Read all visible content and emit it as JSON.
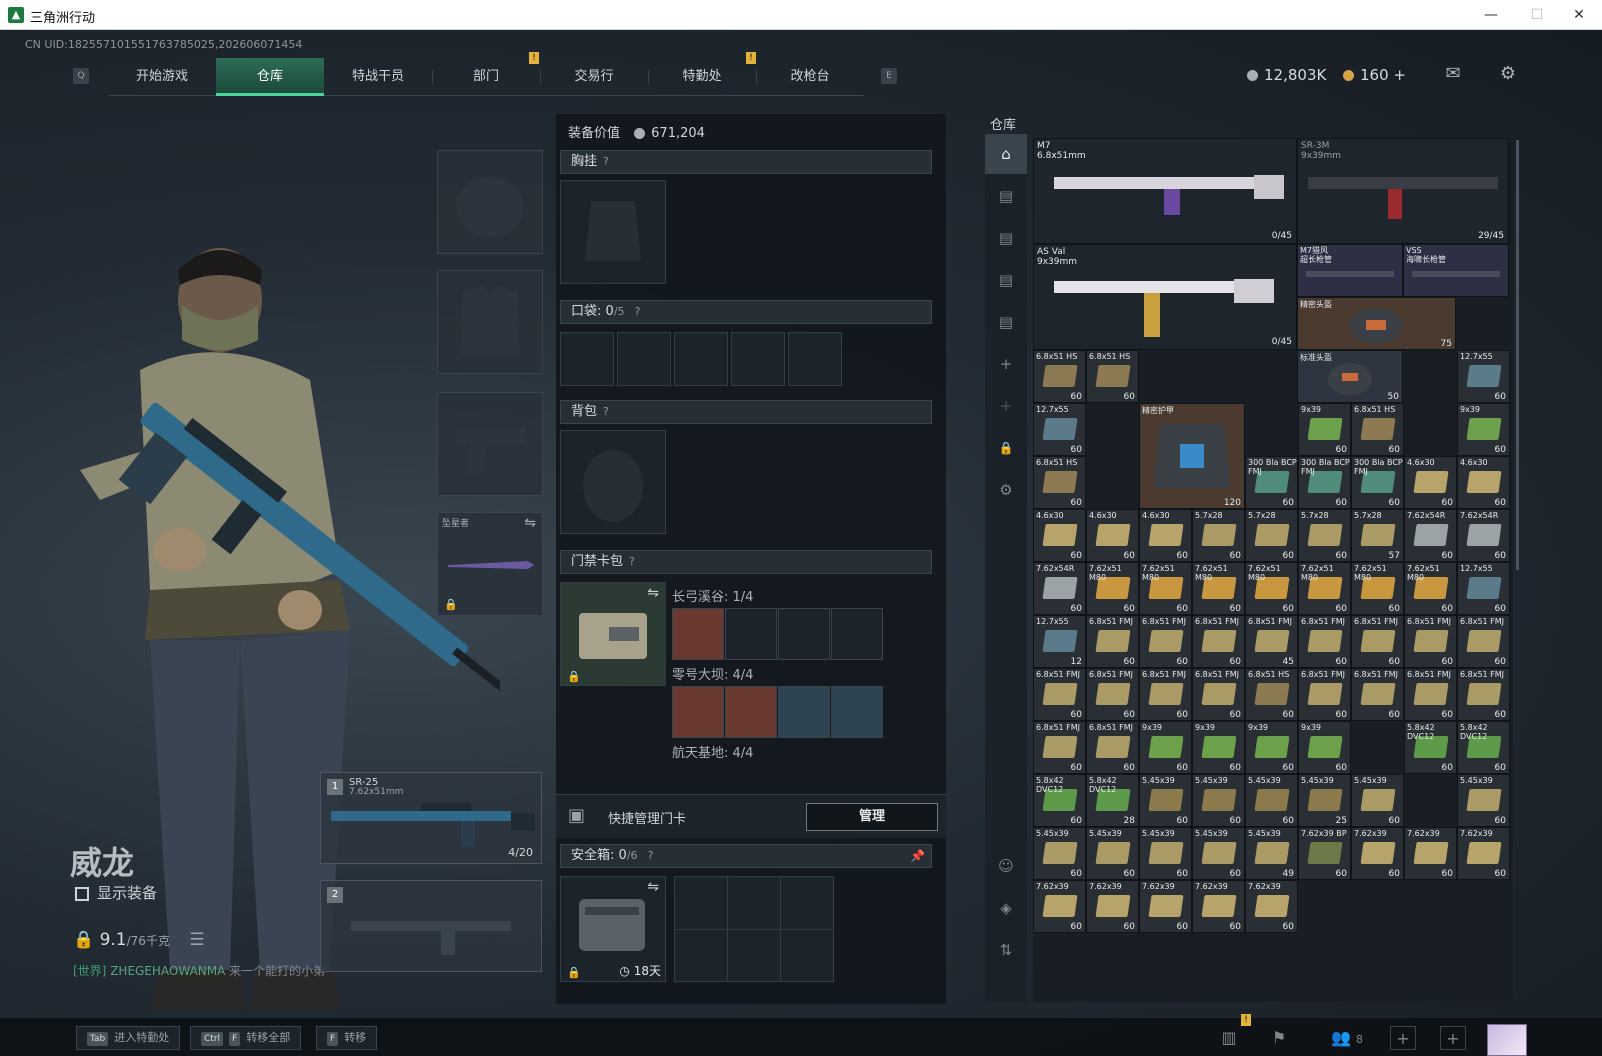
{
  "window": {
    "title": "三角洲行动",
    "minimize": "—",
    "maximize": "☐",
    "close": "✕"
  },
  "uid": "CN UID:18255710155176378502​5,202606071454",
  "nav": {
    "key_left": "Q",
    "key_right": "E",
    "tabs": [
      "开始游戏",
      "仓库",
      "特战干员",
      "部门",
      "交易行",
      "特勤处",
      "改枪台"
    ],
    "active_tab": "仓库",
    "notice_mark": "!"
  },
  "currency": {
    "silver": "12,803K",
    "gold": "160",
    "gold_add": "+"
  },
  "character": {
    "name": "威龙",
    "show_equipment": "显示装备",
    "weight": "9.1",
    "weight_unit": "/76千克"
  },
  "chat": {
    "channel": "[世界]",
    "user": "ZHEGEHAOWANMA",
    "message": "来一个能打的小弟"
  },
  "equip_slots": {
    "melee_label": "坠星者"
  },
  "weapons": [
    {
      "slot": "1",
      "name": "SR-25",
      "caliber": "7.62x51mm",
      "ammo": "4/20"
    },
    {
      "slot": "2",
      "name": "",
      "caliber": "",
      "ammo": ""
    }
  ],
  "loadout": {
    "value_label": "装备价值",
    "value": "671,204",
    "chest_rig": "胸挂",
    "pocket": "口袋:",
    "pocket_count": "0",
    "pocket_max": "/5",
    "backpack": "背包",
    "keycard_bag": "门禁卡包",
    "question": "?",
    "key_rows": [
      {
        "map": "长弓溪谷:",
        "count": "1/4"
      },
      {
        "map": "零号大坝:",
        "count": "4/4"
      },
      {
        "map": "航天基地:",
        "count": "4/4"
      }
    ],
    "quick_manage": "快捷管理门卡",
    "manage_button": "管理",
    "safebox": "安全箱:",
    "safebox_count": "0",
    "safebox_max": "/6",
    "safebox_days": "18天"
  },
  "warehouse": {
    "title": "仓库",
    "weapons": [
      {
        "name": "M7",
        "caliber": "6.8x51mm",
        "ammo": "0/45"
      },
      {
        "name": "SR-3M",
        "caliber": "9x39mm",
        "ammo": "29/45"
      },
      {
        "name": "AS Val",
        "caliber": "9x39mm",
        "ammo": "0/45"
      },
      {
        "name": "M7猎风",
        "caliber": "超长枪管",
        "ammo": ""
      },
      {
        "name": "VSS",
        "caliber": "海啸长枪管",
        "ammo": ""
      }
    ],
    "gear": [
      {
        "name": "精密头盔",
        "durability": "75"
      },
      {
        "name": "标准头盔",
        "durability": "50"
      },
      {
        "name": "精密护甲",
        "durability": "120"
      }
    ],
    "ammo_cells": [
      {
        "label": "6.8x51 HS",
        "count": "60",
        "color": "#8c7a52"
      },
      {
        "label": "6.8x51 HS",
        "count": "60",
        "color": "#8c7a52"
      },
      {
        "label": "12.7x55",
        "count": "60",
        "color": "#5c7b8a"
      },
      {
        "label": "12.7x55",
        "count": "60",
        "color": "#5c7b8a"
      },
      {
        "label": "9x39",
        "count": "60",
        "color": "#6ca04a"
      },
      {
        "label": "6.8x51 HS",
        "count": "60",
        "color": "#8c7a52"
      },
      {
        "label": "9x39",
        "count": "60",
        "color": "#6ca04a"
      },
      {
        "label": "6.8x51 HS",
        "count": "60",
        "color": "#8c7a52"
      },
      {
        "label": "300 Bla BCP FMJ",
        "count": "60",
        "color": "#4f8c7a"
      },
      {
        "label": "300 Bla BCP FMJ",
        "count": "60",
        "color": "#4f8c7a"
      },
      {
        "label": "300 Bla BCP FMJ",
        "count": "60",
        "color": "#4f8c7a"
      },
      {
        "label": "4.6x30",
        "count": "60",
        "color": "#b7a46a"
      },
      {
        "label": "4.6x30",
        "count": "60",
        "color": "#b7a46a"
      },
      {
        "label": "4.6x30",
        "count": "60",
        "color": "#b7a46a"
      },
      {
        "label": "4.6x30",
        "count": "60",
        "color": "#b7a46a"
      },
      {
        "label": "4.6x30",
        "count": "60",
        "color": "#b7a46a"
      },
      {
        "label": "5.7x28",
        "count": "60",
        "color": "#a99a66"
      },
      {
        "label": "5.7x28",
        "count": "60",
        "color": "#a99a66"
      },
      {
        "label": "5.7x28",
        "count": "60",
        "color": "#a99a66"
      },
      {
        "label": "5.7x28",
        "count": "57",
        "color": "#a99a66"
      },
      {
        "label": "7.62x54R",
        "count": "60",
        "color": "#9ba3a6"
      },
      {
        "label": "7.62x54R",
        "count": "60",
        "color": "#9ba3a6"
      },
      {
        "label": "7.62x54R",
        "count": "60",
        "color": "#9ba3a6"
      },
      {
        "label": "7.62x51 M80",
        "count": "60",
        "color": "#c8973f"
      },
      {
        "label": "7.62x51 M80",
        "count": "60",
        "color": "#c8973f"
      },
      {
        "label": "7.62x51 M80",
        "count": "60",
        "color": "#c8973f"
      },
      {
        "label": "7.62x51 M80",
        "count": "60",
        "color": "#c8973f"
      },
      {
        "label": "7.62x51 M80",
        "count": "60",
        "color": "#c8973f"
      },
      {
        "label": "7.62x51 M80",
        "count": "60",
        "color": "#c8973f"
      },
      {
        "label": "7.62x51 M80",
        "count": "60",
        "color": "#c8973f"
      },
      {
        "label": "12.7x55",
        "count": "60",
        "color": "#5c7b8a"
      },
      {
        "label": "12.7x55",
        "count": "12",
        "color": "#5c7b8a"
      },
      {
        "label": "6.8x51 FMJ",
        "count": "60",
        "color": "#a99a66"
      },
      {
        "label": "6.8x51 FMJ",
        "count": "60",
        "color": "#a99a66"
      },
      {
        "label": "6.8x51 FMJ",
        "count": "60",
        "color": "#a99a66"
      },
      {
        "label": "6.8x51 FMJ",
        "count": "45",
        "color": "#a99a66"
      },
      {
        "label": "6.8x51 FMJ",
        "count": "60",
        "color": "#a99a66"
      },
      {
        "label": "6.8x51 FMJ",
        "count": "60",
        "color": "#a99a66"
      },
      {
        "label": "6.8x51 FMJ",
        "count": "60",
        "color": "#a99a66"
      },
      {
        "label": "6.8x51 FMJ",
        "count": "60",
        "color": "#a99a66"
      },
      {
        "label": "6.8x51 FMJ",
        "count": "60",
        "color": "#a99a66"
      },
      {
        "label": "6.8x51 FMJ",
        "count": "60",
        "color": "#a99a66"
      },
      {
        "label": "6.8x51 FMJ",
        "count": "60",
        "color": "#a99a66"
      },
      {
        "label": "6.8x51 FMJ",
        "count": "60",
        "color": "#a99a66"
      },
      {
        "label": "6.8x51 HS",
        "count": "60",
        "color": "#8c7a52"
      },
      {
        "label": "6.8x51 FMJ",
        "count": "60",
        "color": "#a99a66"
      },
      {
        "label": "6.8x51 FMJ",
        "count": "60",
        "color": "#a99a66"
      },
      {
        "label": "6.8x51 FMJ",
        "count": "60",
        "color": "#a99a66"
      },
      {
        "label": "6.8x51 FMJ",
        "count": "60",
        "color": "#a99a66"
      },
      {
        "label": "6.8x51 FMJ",
        "count": "60",
        "color": "#a99a66"
      },
      {
        "label": "6.8x51 FMJ",
        "count": "60",
        "color": "#a99a66"
      },
      {
        "label": "9x39",
        "count": "60",
        "color": "#6ca04a"
      },
      {
        "label": "9x39",
        "count": "60",
        "color": "#6ca04a"
      },
      {
        "label": "9x39",
        "count": "60",
        "color": "#6ca04a"
      },
      {
        "label": "9x39",
        "count": "60",
        "color": "#6ca04a"
      },
      {
        "label": "5.8x42 DVC12",
        "count": "60",
        "color": "#5d9a4a"
      },
      {
        "label": "5.8x42 DVC12",
        "count": "60",
        "color": "#5d9a4a"
      },
      {
        "label": "5.8x42 DVC12",
        "count": "60",
        "color": "#5d9a4a"
      },
      {
        "label": "5.8x42 DVC12",
        "count": "28",
        "color": "#5d9a4a"
      },
      {
        "label": "5.45x39",
        "count": "60",
        "color": "#8d7a4a"
      },
      {
        "label": "5.45x39",
        "count": "60",
        "color": "#8d7a4a"
      },
      {
        "label": "5.45x39",
        "count": "60",
        "color": "#8d7a4a"
      },
      {
        "label": "5.45x39",
        "count": "25",
        "color": "#8d7a4a"
      },
      {
        "label": "5.45x39",
        "count": "60",
        "color": "#a99a66"
      },
      {
        "label": "5.45x39",
        "count": "60",
        "color": "#a99a66"
      },
      {
        "label": "5.45x39",
        "count": "60",
        "color": "#a99a66"
      },
      {
        "label": "5.45x39",
        "count": "60",
        "color": "#a99a66"
      },
      {
        "label": "5.45x39",
        "count": "60",
        "color": "#a99a66"
      },
      {
        "label": "5.45x39",
        "count": "60",
        "color": "#a99a66"
      },
      {
        "label": "5.45x39",
        "count": "49",
        "color": "#a99a66"
      },
      {
        "label": "7.62x39 BP",
        "count": "60",
        "color": "#6c7a4a"
      },
      {
        "label": "7.62x39",
        "count": "60",
        "color": "#b7a46a"
      },
      {
        "label": "7.62x39",
        "count": "60",
        "color": "#b7a46a"
      },
      {
        "label": "7.62x39",
        "count": "60",
        "color": "#b7a46a"
      },
      {
        "label": "7.62x39",
        "count": "60",
        "color": "#b7a46a"
      },
      {
        "label": "7.62x39",
        "count": "60",
        "color": "#b7a46a"
      },
      {
        "label": "7.62x39",
        "count": "60",
        "color": "#b7a46a"
      },
      {
        "label": "7.62x39",
        "count": "60",
        "color": "#b7a46a"
      },
      {
        "label": "7.62x39",
        "count": "60",
        "color": "#b7a46a"
      }
    ]
  },
  "bottom": {
    "hints": [
      {
        "key": "Tab",
        "key2": "",
        "text": "进入特勤处"
      },
      {
        "key": "Ctrl",
        "key2": "F",
        "text": "转移全部"
      },
      {
        "key": "F",
        "key2": "",
        "text": "转移"
      }
    ],
    "friends": "8"
  }
}
